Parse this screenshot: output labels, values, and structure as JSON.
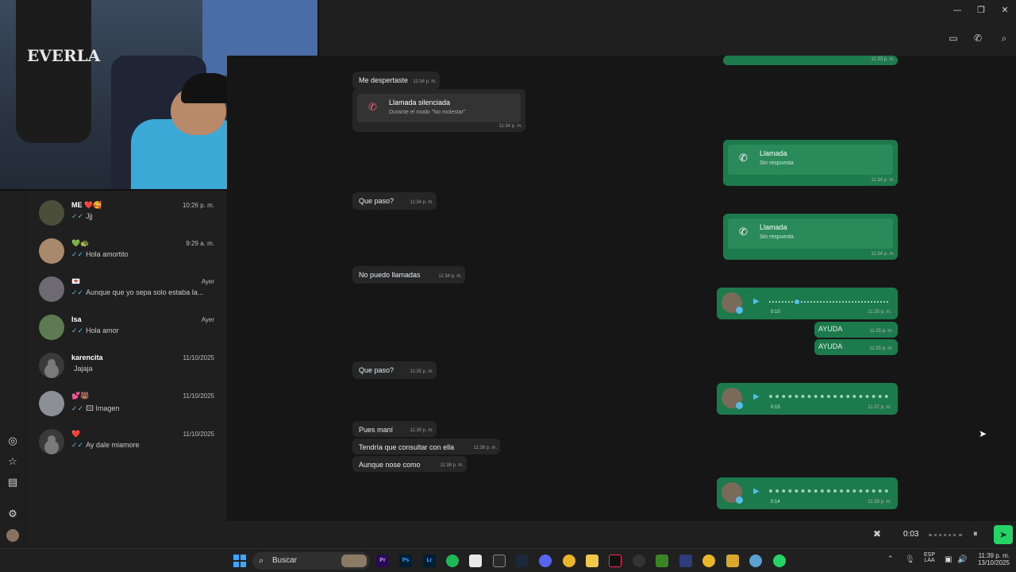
{
  "titlebar": {
    "minimize": "—",
    "restore": "❐",
    "close": "✕"
  },
  "webcam": {
    "shirt_text": "EVERLA"
  },
  "rail": {
    "icons": [
      "status-icon",
      "starred-icon",
      "archive-icon",
      "settings-icon",
      "profile-avatar"
    ]
  },
  "chats": [
    {
      "name": "ME ❤️🥰",
      "time": "10:26 p. m.",
      "preview": "Jjj",
      "tick": "✓✓"
    },
    {
      "name": "💚🐢",
      "time": "9:29 a. m.",
      "preview": "Hola amortito",
      "tick": "✓✓"
    },
    {
      "name": "💌",
      "time": "Ayer",
      "preview": "Aunque que yo sepa solo estaba la...",
      "tick": "✓✓"
    },
    {
      "name": "Isa",
      "time": "Ayer",
      "preview": "Hola amor",
      "tick": "✓✓"
    },
    {
      "name": "karencita",
      "time": "11/10/2025",
      "preview": "Jajaja",
      "tick": ""
    },
    {
      "name": "💕🐻",
      "time": "11/10/2025",
      "preview": "🖾 Imagen",
      "tick": "✓✓"
    },
    {
      "name": "❤️",
      "time": "11/10/2025",
      "preview": "Ay dale miamore",
      "tick": "✓✓"
    }
  ],
  "messages": {
    "top_out_time": "11:33 p. m.",
    "m1": {
      "text": "Me despertaste",
      "time": "11:34 p. m."
    },
    "muted_call": {
      "title": "Llamada silenciada",
      "sub": "Durante el modo \"No molestar\"",
      "time": "11:34 p. m."
    },
    "call1": {
      "title": "Llamada",
      "sub": "Sin respuesta",
      "time": "11:34 p. m."
    },
    "m2": {
      "text": "Que paso?",
      "time": "11:34 p. m."
    },
    "call2": {
      "title": "Llamada",
      "sub": "Sin respuesta",
      "time": "11:34 p. m."
    },
    "m3": {
      "text": "No puedo llamadas",
      "time": "11:34 p. m."
    },
    "voice1": {
      "duration": "0:10",
      "time": "11:35 p. m."
    },
    "ayuda1": {
      "text": "AYUDA",
      "time": "11:35 p. m."
    },
    "ayuda2": {
      "text": "AYUDA",
      "time": "11:35 p. m."
    },
    "m4": {
      "text": "Que paso?",
      "time": "11:35 p. m."
    },
    "voice2": {
      "duration": "0:15",
      "time": "11:37 p. m."
    },
    "m5": {
      "text": "Pues maní",
      "time": "11:38 p. m."
    },
    "m6": {
      "text": "Tendría que consultar con ella",
      "time": "11:38 p. m."
    },
    "m7": {
      "text": "Aunque nose como",
      "time": "11:38 p. m."
    },
    "voice3": {
      "duration": "0:14",
      "time": "11:39 p. m."
    }
  },
  "recording": {
    "elapsed": "0:03",
    "pause": "⏸",
    "send": "➤",
    "delete": "🗑"
  },
  "taskbar": {
    "search_placeholder": "Buscar",
    "apps": [
      "Pr",
      "Ps",
      "Lr"
    ],
    "lang": "ESP",
    "lang2": "LAA",
    "time": "11:39 p. m.",
    "date": "13/10/2025"
  },
  "colors": {
    "accent": "#25d366",
    "bubble_out": "#1d7a4c",
    "bubble_in": "#262626",
    "tick": "#53bdeb"
  }
}
